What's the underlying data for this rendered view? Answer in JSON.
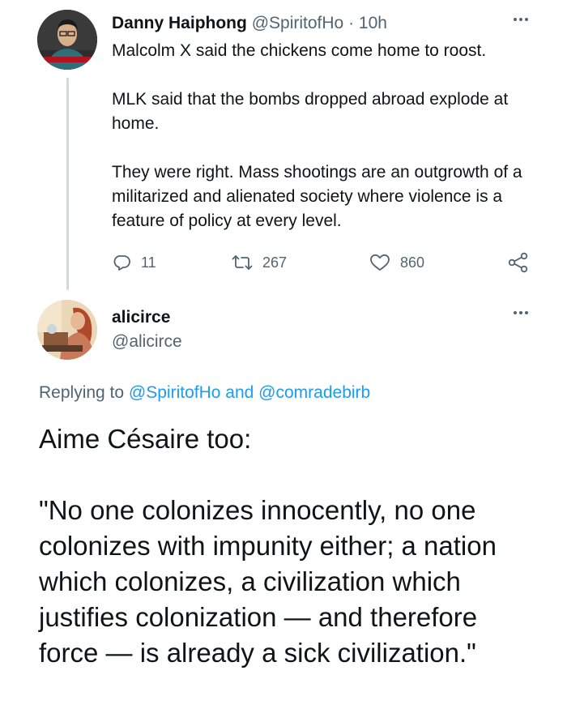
{
  "tweet1": {
    "author_name": "Danny Haiphong",
    "author_handle": "@SpiritofHo",
    "separator": "·",
    "timestamp": "10h",
    "paragraphs": [
      "Malcolm X said the chickens come home to roost.",
      "MLK said that the bombs dropped abroad explode at home.",
      "They were right. Mass shootings are an outgrowth of a militarized and alienated society where violence is a feature of policy at every level."
    ],
    "stats": {
      "replies": "11",
      "retweets": "267",
      "likes": "860"
    }
  },
  "tweet2": {
    "author_name": "alicirce",
    "author_handle": "@alicirce",
    "replying": {
      "prefix": "Replying to",
      "user1": "@SpiritofHo",
      "conjunction": "and",
      "user2": "@comradebirb"
    },
    "paragraphs": [
      "Aime Césaire too:",
      "\"No one colonizes innocently, no one colonizes with impunity either; a nation which colonizes, a civilization which justifies colonization — and therefore force — is already a sick civilization.\""
    ]
  },
  "colors": {
    "text": "#0f1419",
    "muted": "#536471",
    "link": "#1d9bf0",
    "thread_line": "#cfd9de"
  },
  "icons": {
    "reply": "reply-icon",
    "retweet": "retweet-icon",
    "like": "heart-icon",
    "share": "share-icon",
    "more": "more-icon"
  }
}
